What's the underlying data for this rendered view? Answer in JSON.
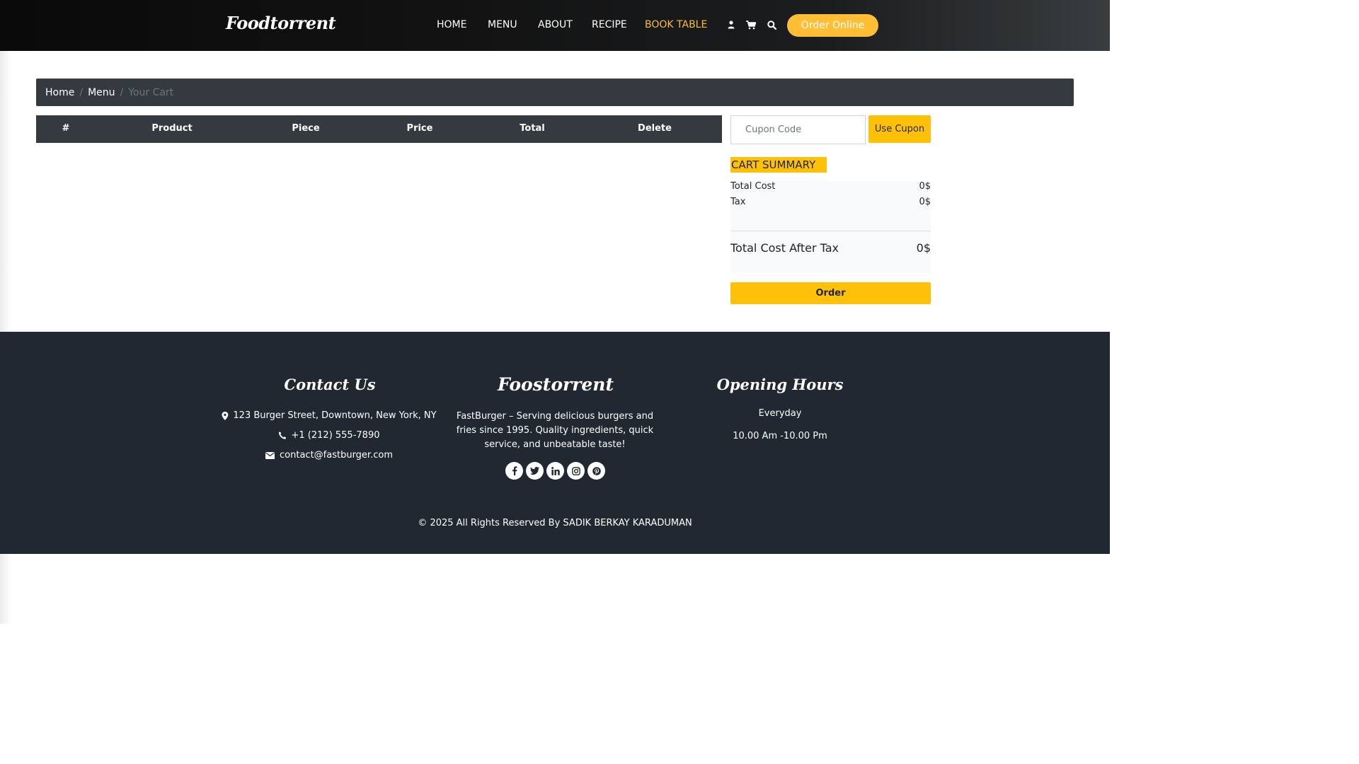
{
  "header": {
    "brand": "Foodtorrent",
    "nav": [
      {
        "label": "HOME",
        "active": false
      },
      {
        "label": "MENU",
        "active": false
      },
      {
        "label": "ABOUT",
        "active": false
      },
      {
        "label": "RECIPE",
        "active": false
      },
      {
        "label": "BOOK TABLE",
        "active": true
      }
    ],
    "icons": [
      "user-icon",
      "cart-icon",
      "search-icon"
    ],
    "order_online": "Order Online"
  },
  "breadcrumb": {
    "items": [
      "Home",
      "Menu"
    ],
    "current": "Your Cart",
    "separator": "/"
  },
  "cart_table": {
    "columns": [
      "#",
      "Product",
      "Piece",
      "Price",
      "Total",
      "Delete"
    ],
    "rows": []
  },
  "coupon": {
    "placeholder": "Cupon Code",
    "value": "",
    "button": "Use Cupon"
  },
  "summary": {
    "title": "CART SUMMARY",
    "total_cost_label": "Total Cost",
    "total_cost": "0$",
    "tax_label": "Tax",
    "tax": "0$",
    "after_tax_label": "Total Cost After Tax",
    "after_tax": "0$",
    "order_button": "Order"
  },
  "footer": {
    "contact": {
      "title": "Contact Us",
      "address": "123 Burger Street, Downtown, New York, NY",
      "phone": "+1 (212) 555-7890",
      "email": "contact@fastburger.com"
    },
    "about": {
      "title": "Foostorrent",
      "text": "FastBurger – Serving delicious burgers and fries since 1995. Quality ingredients, quick service, and unbeatable taste!",
      "socials": [
        "facebook-icon",
        "twitter-icon",
        "linkedin-icon",
        "instagram-icon",
        "pinterest-icon"
      ]
    },
    "hours": {
      "title": "Opening Hours",
      "days": "Everyday",
      "time": "10.00 Am -10.00 Pm"
    },
    "copyright": "© 2025 All Rights Reserved By SADIK BERKAY KARADUMAN"
  },
  "colors": {
    "accent": "#ffbe33",
    "button_yellow": "#ffc107",
    "dark_bar": "#343a40",
    "footer_bg": "#222831"
  }
}
